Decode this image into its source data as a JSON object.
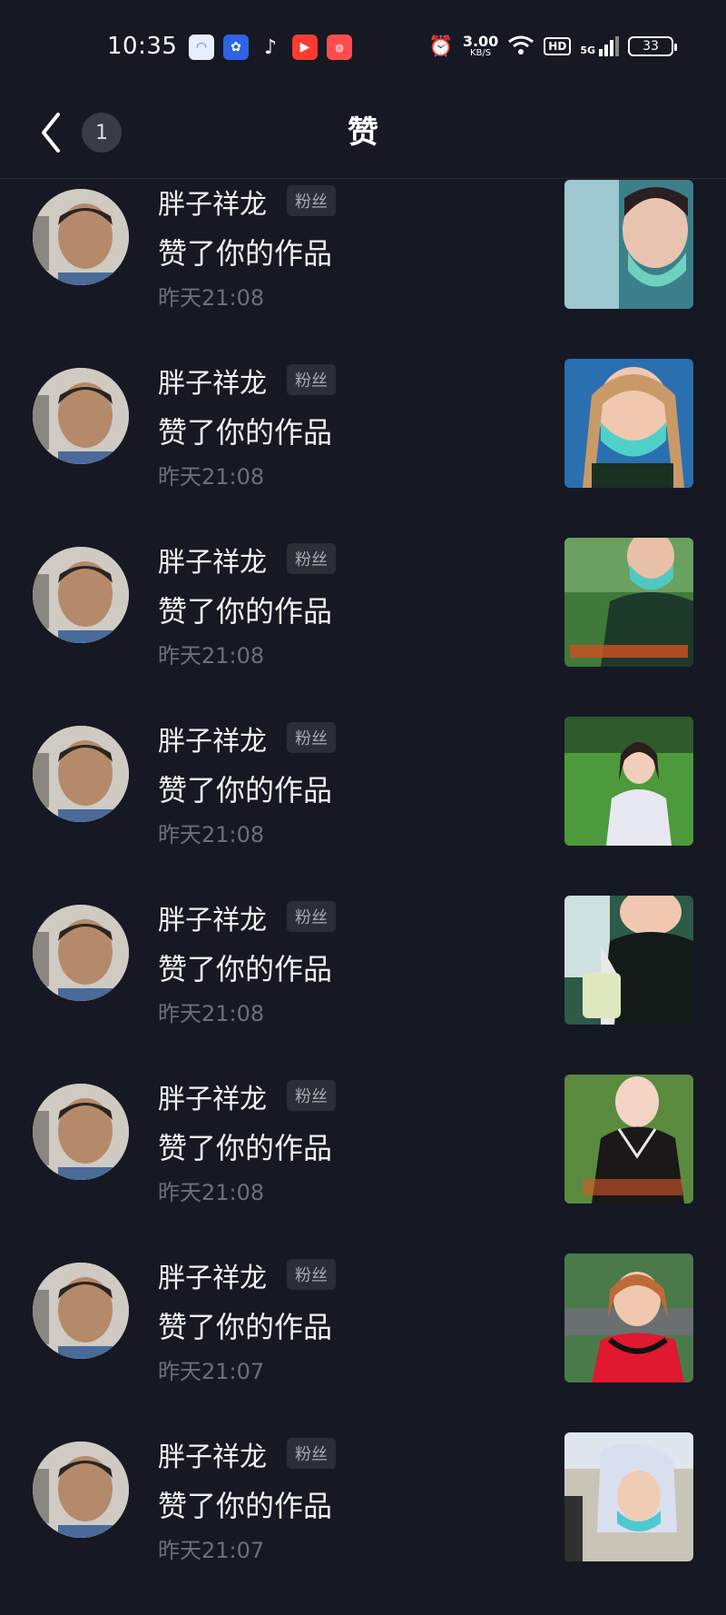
{
  "status": {
    "time": "10:35",
    "net_speed_value": "3.00",
    "net_speed_unit": "KB/S",
    "hd": "HD",
    "network": "5G",
    "battery": "33"
  },
  "header": {
    "title": "赞",
    "unread_count": "1"
  },
  "items": [
    {
      "name": "胖子祥龙",
      "tag": "粉丝",
      "action": "赞了你的作品",
      "time": "昨天21:08"
    },
    {
      "name": "胖子祥龙",
      "tag": "粉丝",
      "action": "赞了你的作品",
      "time": "昨天21:08"
    },
    {
      "name": "胖子祥龙",
      "tag": "粉丝",
      "action": "赞了你的作品",
      "time": "昨天21:08"
    },
    {
      "name": "胖子祥龙",
      "tag": "粉丝",
      "action": "赞了你的作品",
      "time": "昨天21:08"
    },
    {
      "name": "胖子祥龙",
      "tag": "粉丝",
      "action": "赞了你的作品",
      "time": "昨天21:08"
    },
    {
      "name": "胖子祥龙",
      "tag": "粉丝",
      "action": "赞了你的作品",
      "time": "昨天21:08"
    },
    {
      "name": "胖子祥龙",
      "tag": "粉丝",
      "action": "赞了你的作品",
      "time": "昨天21:07"
    },
    {
      "name": "胖子祥龙",
      "tag": "粉丝",
      "action": "赞了你的作品",
      "time": "昨天21:07"
    }
  ],
  "colors": {
    "background": "#161823",
    "secondary_text": "#6c6e78"
  }
}
